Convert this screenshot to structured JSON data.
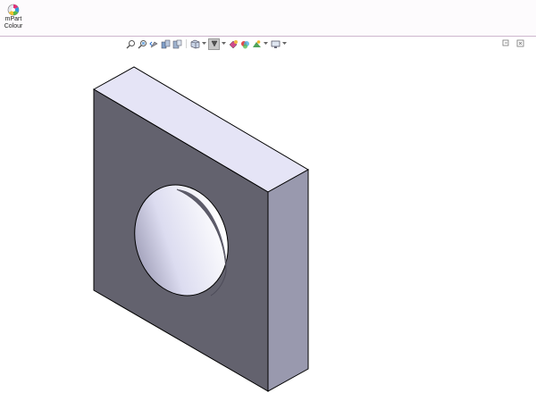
{
  "ribbon": {
    "mpart_button": {
      "label_line1": "mPart",
      "label_line2": "Colour",
      "icon": "color-palette-icon"
    }
  },
  "view_toolbar": {
    "icons": [
      "zoom-to-fit-icon",
      "zoom-to-area-icon",
      "previous-view-icon",
      "section-view-icon",
      "dynamic-annotation-views-icon",
      "view-orientation-icon",
      "display-style-icon",
      "hide-show-items-icon",
      "edit-appearance-icon",
      "apply-scene-icon",
      "view-settings-icon"
    ]
  },
  "window_controls": {
    "icons": [
      "restore-window-icon",
      "close-pane-icon"
    ]
  },
  "colors": {
    "ribbon_bg": "#fdfbfd",
    "ribbon_border": "#cdb6cd",
    "front_face": "#63626e",
    "top_face": "#e5e4f6",
    "side_face": "#9999ae",
    "edge": "#000000"
  }
}
